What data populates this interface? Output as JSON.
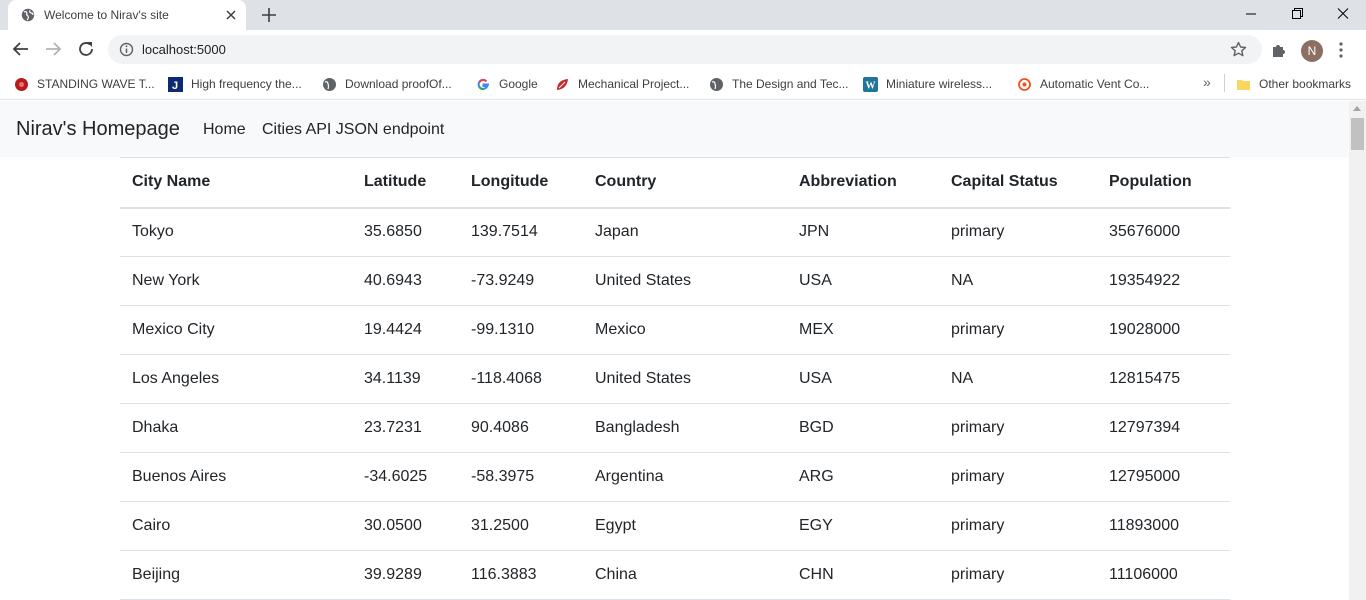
{
  "browser": {
    "tab_title": "Welcome to Nirav's site",
    "url": "localhost:5000",
    "profile_initial": "N",
    "bookmarks": [
      {
        "label": "STANDING WAVE T...",
        "icon": "red-bug-icon"
      },
      {
        "label": "High frequency the...",
        "icon": "journal-j-icon"
      },
      {
        "label": "Download proofOf...",
        "icon": "globe-icon"
      },
      {
        "label": "Google",
        "icon": "google-icon"
      },
      {
        "label": "Mechanical Project...",
        "icon": "red-leaf-icon"
      },
      {
        "label": "The Design and Tec...",
        "icon": "globe-icon"
      },
      {
        "label": "Miniature wireless...",
        "icon": "wordpress-icon"
      },
      {
        "label": "Automatic Vent Co...",
        "icon": "orange-swirl-icon"
      }
    ],
    "overflow_label": "»",
    "other_bookmarks": "Other bookmarks"
  },
  "navbar": {
    "brand": "Nirav's Homepage",
    "links": [
      "Home",
      "Cities API JSON endpoint"
    ]
  },
  "table": {
    "headers": [
      "City Name",
      "Latitude",
      "Longitude",
      "Country",
      "Abbreviation",
      "Capital Status",
      "Population"
    ],
    "rows": [
      [
        "Tokyo",
        "35.6850",
        "139.7514",
        "Japan",
        "JPN",
        "primary",
        "35676000"
      ],
      [
        "New York",
        "40.6943",
        "-73.9249",
        "United States",
        "USA",
        "NA",
        "19354922"
      ],
      [
        "Mexico City",
        "19.4424",
        "-99.1310",
        "Mexico",
        "MEX",
        "primary",
        "19028000"
      ],
      [
        "Los Angeles",
        "34.1139",
        "-118.4068",
        "United States",
        "USA",
        "NA",
        "12815475"
      ],
      [
        "Dhaka",
        "23.7231",
        "90.4086",
        "Bangladesh",
        "BGD",
        "primary",
        "12797394"
      ],
      [
        "Buenos Aires",
        "-34.6025",
        "-58.3975",
        "Argentina",
        "ARG",
        "primary",
        "12795000"
      ],
      [
        "Cairo",
        "30.0500",
        "31.2500",
        "Egypt",
        "EGY",
        "primary",
        "11893000"
      ],
      [
        "Beijing",
        "39.9289",
        "116.3883",
        "China",
        "CHN",
        "primary",
        "11106000"
      ]
    ]
  }
}
